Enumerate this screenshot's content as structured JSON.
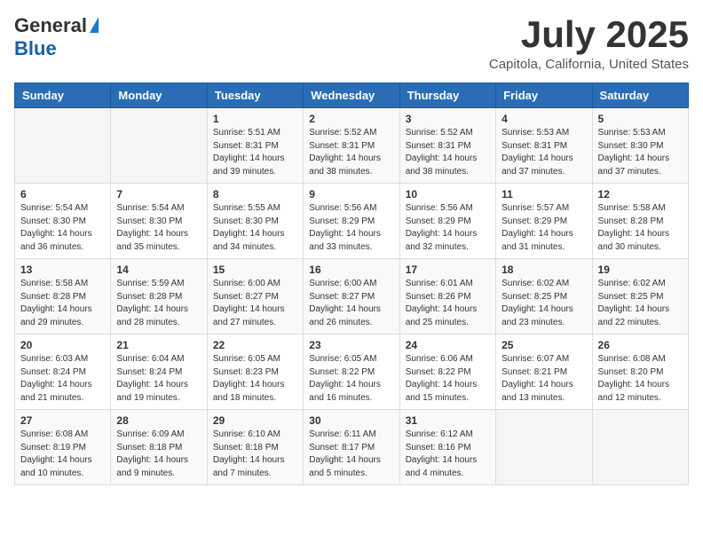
{
  "logo": {
    "general": "General",
    "blue": "Blue"
  },
  "title": "July 2025",
  "location": "Capitola, California, United States",
  "headers": [
    "Sunday",
    "Monday",
    "Tuesday",
    "Wednesday",
    "Thursday",
    "Friday",
    "Saturday"
  ],
  "weeks": [
    [
      {
        "day": "",
        "info": ""
      },
      {
        "day": "",
        "info": ""
      },
      {
        "day": "1",
        "info": "Sunrise: 5:51 AM\nSunset: 8:31 PM\nDaylight: 14 hours and 39 minutes."
      },
      {
        "day": "2",
        "info": "Sunrise: 5:52 AM\nSunset: 8:31 PM\nDaylight: 14 hours and 38 minutes."
      },
      {
        "day": "3",
        "info": "Sunrise: 5:52 AM\nSunset: 8:31 PM\nDaylight: 14 hours and 38 minutes."
      },
      {
        "day": "4",
        "info": "Sunrise: 5:53 AM\nSunset: 8:31 PM\nDaylight: 14 hours and 37 minutes."
      },
      {
        "day": "5",
        "info": "Sunrise: 5:53 AM\nSunset: 8:30 PM\nDaylight: 14 hours and 37 minutes."
      }
    ],
    [
      {
        "day": "6",
        "info": "Sunrise: 5:54 AM\nSunset: 8:30 PM\nDaylight: 14 hours and 36 minutes."
      },
      {
        "day": "7",
        "info": "Sunrise: 5:54 AM\nSunset: 8:30 PM\nDaylight: 14 hours and 35 minutes."
      },
      {
        "day": "8",
        "info": "Sunrise: 5:55 AM\nSunset: 8:30 PM\nDaylight: 14 hours and 34 minutes."
      },
      {
        "day": "9",
        "info": "Sunrise: 5:56 AM\nSunset: 8:29 PM\nDaylight: 14 hours and 33 minutes."
      },
      {
        "day": "10",
        "info": "Sunrise: 5:56 AM\nSunset: 8:29 PM\nDaylight: 14 hours and 32 minutes."
      },
      {
        "day": "11",
        "info": "Sunrise: 5:57 AM\nSunset: 8:29 PM\nDaylight: 14 hours and 31 minutes."
      },
      {
        "day": "12",
        "info": "Sunrise: 5:58 AM\nSunset: 8:28 PM\nDaylight: 14 hours and 30 minutes."
      }
    ],
    [
      {
        "day": "13",
        "info": "Sunrise: 5:58 AM\nSunset: 8:28 PM\nDaylight: 14 hours and 29 minutes."
      },
      {
        "day": "14",
        "info": "Sunrise: 5:59 AM\nSunset: 8:28 PM\nDaylight: 14 hours and 28 minutes."
      },
      {
        "day": "15",
        "info": "Sunrise: 6:00 AM\nSunset: 8:27 PM\nDaylight: 14 hours and 27 minutes."
      },
      {
        "day": "16",
        "info": "Sunrise: 6:00 AM\nSunset: 8:27 PM\nDaylight: 14 hours and 26 minutes."
      },
      {
        "day": "17",
        "info": "Sunrise: 6:01 AM\nSunset: 8:26 PM\nDaylight: 14 hours and 25 minutes."
      },
      {
        "day": "18",
        "info": "Sunrise: 6:02 AM\nSunset: 8:25 PM\nDaylight: 14 hours and 23 minutes."
      },
      {
        "day": "19",
        "info": "Sunrise: 6:02 AM\nSunset: 8:25 PM\nDaylight: 14 hours and 22 minutes."
      }
    ],
    [
      {
        "day": "20",
        "info": "Sunrise: 6:03 AM\nSunset: 8:24 PM\nDaylight: 14 hours and 21 minutes."
      },
      {
        "day": "21",
        "info": "Sunrise: 6:04 AM\nSunset: 8:24 PM\nDaylight: 14 hours and 19 minutes."
      },
      {
        "day": "22",
        "info": "Sunrise: 6:05 AM\nSunset: 8:23 PM\nDaylight: 14 hours and 18 minutes."
      },
      {
        "day": "23",
        "info": "Sunrise: 6:05 AM\nSunset: 8:22 PM\nDaylight: 14 hours and 16 minutes."
      },
      {
        "day": "24",
        "info": "Sunrise: 6:06 AM\nSunset: 8:22 PM\nDaylight: 14 hours and 15 minutes."
      },
      {
        "day": "25",
        "info": "Sunrise: 6:07 AM\nSunset: 8:21 PM\nDaylight: 14 hours and 13 minutes."
      },
      {
        "day": "26",
        "info": "Sunrise: 6:08 AM\nSunset: 8:20 PM\nDaylight: 14 hours and 12 minutes."
      }
    ],
    [
      {
        "day": "27",
        "info": "Sunrise: 6:08 AM\nSunset: 8:19 PM\nDaylight: 14 hours and 10 minutes."
      },
      {
        "day": "28",
        "info": "Sunrise: 6:09 AM\nSunset: 8:18 PM\nDaylight: 14 hours and 9 minutes."
      },
      {
        "day": "29",
        "info": "Sunrise: 6:10 AM\nSunset: 8:18 PM\nDaylight: 14 hours and 7 minutes."
      },
      {
        "day": "30",
        "info": "Sunrise: 6:11 AM\nSunset: 8:17 PM\nDaylight: 14 hours and 5 minutes."
      },
      {
        "day": "31",
        "info": "Sunrise: 6:12 AM\nSunset: 8:16 PM\nDaylight: 14 hours and 4 minutes."
      },
      {
        "day": "",
        "info": ""
      },
      {
        "day": "",
        "info": ""
      }
    ]
  ]
}
